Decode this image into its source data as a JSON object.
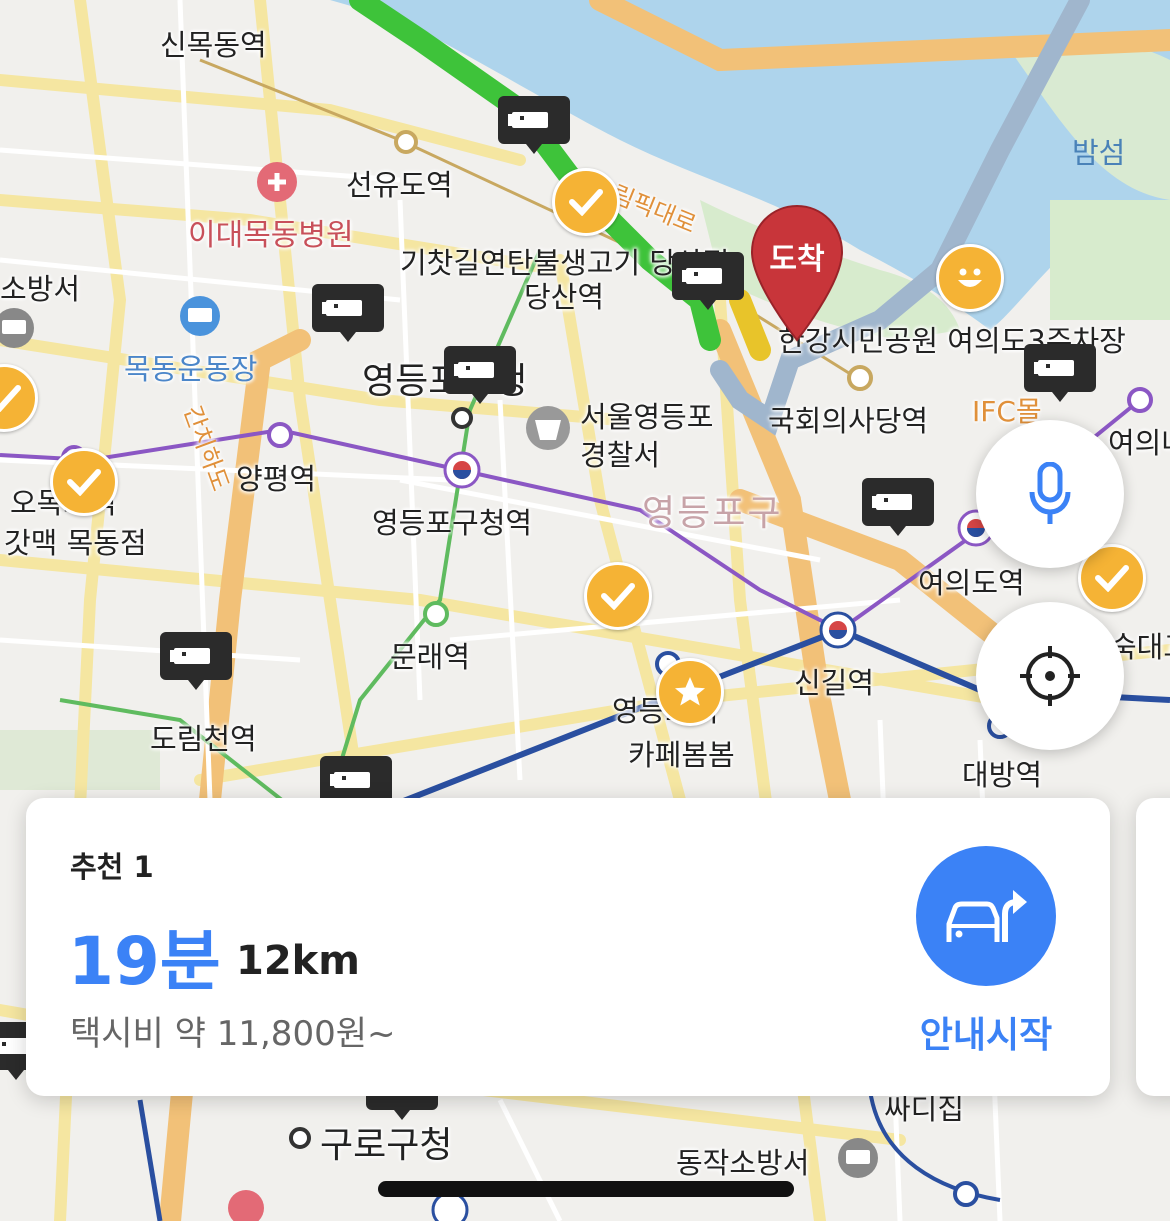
{
  "map": {
    "labels": {
      "sinmokdong": "신목동역",
      "seonyudo": "선유도역",
      "edaemokdong": "이대목동병원",
      "sobangseo": "소방서",
      "mokdong_stadium": "목동운동장",
      "gangbyeon": "간치하도",
      "gichatgil": "기찻길연탄불생고기 당산점",
      "dangsan": "당산역",
      "yeongdeungpo_office": "영등포구청",
      "seoul_police": "서울영등포",
      "police2": "경찰서",
      "yangpyeong": "양평역",
      "ogeum": "오목교역",
      "gatmaek": "갓맥 목동점",
      "ydp_gu_station": "영등포구청역",
      "ydp_gu": "영등포구",
      "munrae": "문래역",
      "dorimcheon": "도림천역",
      "ydp_station": "영등포역",
      "cafe": "카페봄봄",
      "singil": "신길역",
      "daebang": "대방역",
      "yeouido": "여의도역",
      "national_assembly": "국회의사당역",
      "hangang_park": "한강시민공원 여의도3주차장",
      "bamseom": "밤섬",
      "ifc": "IFC몰",
      "yeouinaru": "여의나루",
      "olympic": "올림픽대로",
      "sodaegu": "숙대교",
      "guro_office": "구로구청",
      "dongjak_fire": "동작소방서",
      "ssaditjip": "싸디집"
    },
    "destination_pin": "도착"
  },
  "controls": {
    "mic_icon": "microphone-icon",
    "locate_icon": "crosshair-icon"
  },
  "route_card": {
    "recommend": "추천 1",
    "duration": "19분",
    "distance": "12km",
    "taxi_fare": "택시비 약 11,800원~",
    "start_label": "안내시작"
  },
  "colors": {
    "accent": "#3b82f6",
    "route_green": "#3ec33a",
    "route_yellow": "#e8c42a",
    "route_blue": "#9aaecb",
    "pin_red": "#c8353a",
    "river": "#aed4ec"
  }
}
